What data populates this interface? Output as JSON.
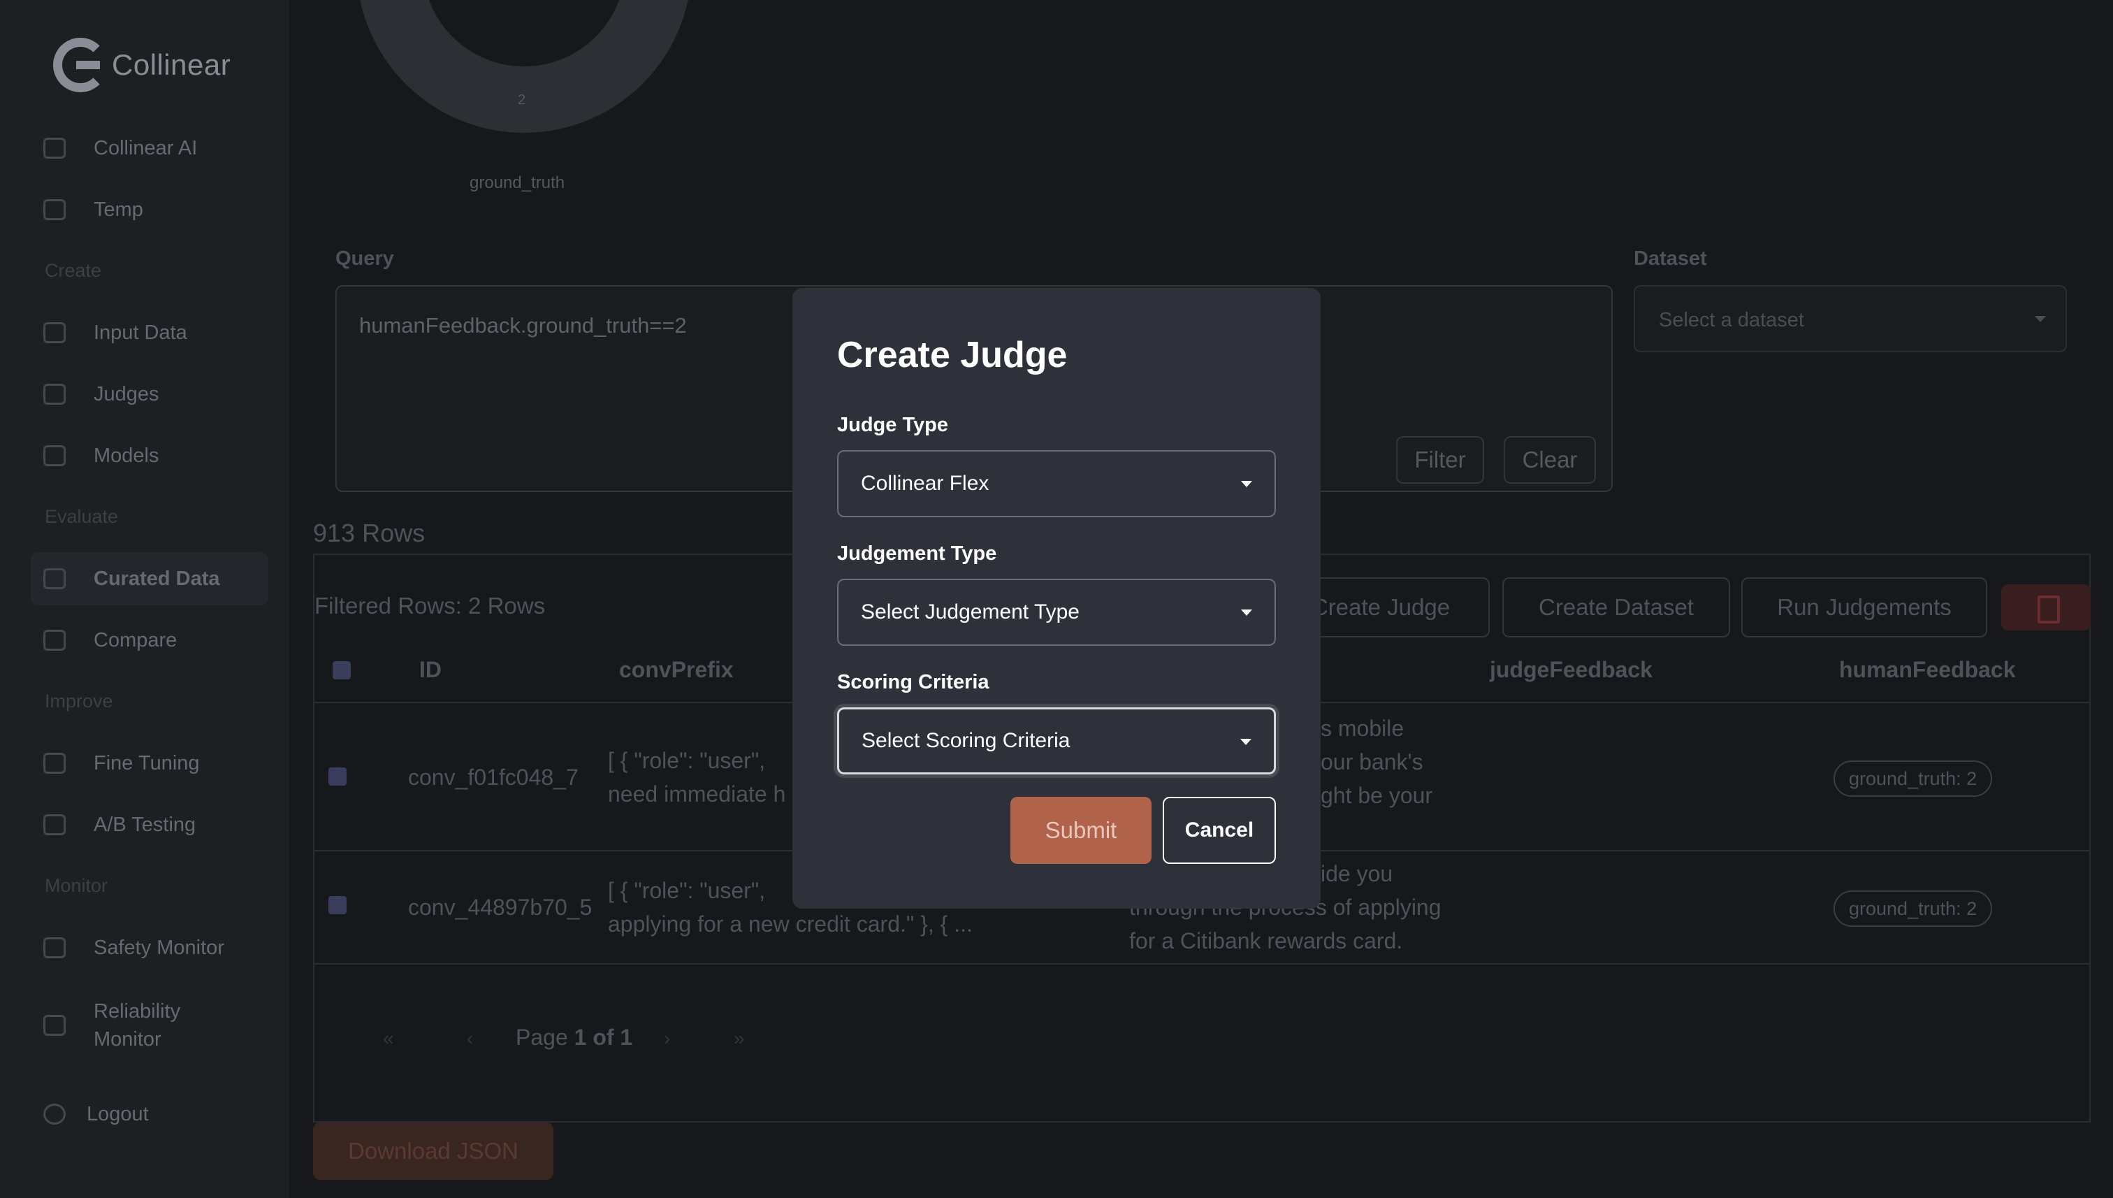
{
  "app": {
    "logo_text": "Collinear"
  },
  "sidebar": {
    "items": [
      {
        "label": "Collinear AI",
        "icon": "sparkle-icon"
      },
      {
        "label": "Temp",
        "icon": "grid-icon"
      },
      {
        "label": "Input Data",
        "icon": "table-icon"
      },
      {
        "label": "Judges",
        "icon": "scale-icon"
      },
      {
        "label": "Models",
        "icon": "model-icon"
      },
      {
        "label": "Curated Data",
        "icon": "list-icon",
        "active": true
      },
      {
        "label": "Compare",
        "icon": "compare-icon"
      },
      {
        "label": "Fine Tuning",
        "icon": "tune-icon"
      },
      {
        "label": "A/B Testing",
        "icon": "ab-icon"
      },
      {
        "label": "Safety Monitor",
        "icon": "monitor-icon"
      },
      {
        "label": "Reliability Monitor",
        "icon": "monitor-icon"
      }
    ],
    "sections": [
      "Create",
      "Evaluate",
      "Improve",
      "Monitor"
    ],
    "logout_label": "Logout"
  },
  "chart": {
    "center_value": "2",
    "label": "ground_truth"
  },
  "query": {
    "label": "Query",
    "value": "humanFeedback.ground_truth==2",
    "filter_label": "Filter",
    "clear_label": "Clear"
  },
  "dataset": {
    "label": "Dataset",
    "placeholder": "Select a dataset"
  },
  "table": {
    "rows_title": "913 Rows",
    "filtered_label": "Filtered Rows: 2 Rows",
    "buttons": {
      "create_judge": "Create Judge",
      "create_dataset": "Create Dataset",
      "run_judgements": "Run Judgements"
    },
    "columns": [
      "ID",
      "convPrefix",
      "judgeFeedback",
      "humanFeedback"
    ],
    "rows": [
      {
        "id": "conv_f01fc048_7",
        "prefix_line1": "[ { \"role\": \"user\",",
        "prefix_line2": "need immediate h",
        "resp_line1": "s mobile",
        "resp_line2": "our bank's",
        "resp_line3": "ght be your",
        "human": "ground_truth: 2"
      },
      {
        "id": "conv_44897b70_5",
        "prefix_line1": "[ { \"role\": \"user\",",
        "prefix_line2": "applying for a new credit card.\" }, { ...",
        "resp_line1": "ide you",
        "resp_line2": "through the process of applying",
        "resp_line3": "for a Citibank rewards card.",
        "human": "ground_truth: 2"
      }
    ],
    "pager": {
      "prefix": "Page",
      "current": "1",
      "of": "of",
      "total": "1"
    }
  },
  "download_label": "Download JSON",
  "modal": {
    "title": "Create Judge",
    "judge_type_label": "Judge Type",
    "judge_type_value": "Collinear Flex",
    "judgement_type_label": "Judgement Type",
    "judgement_type_value": "Select Judgement Type",
    "scoring_label": "Scoring Criteria",
    "scoring_value": "Select Scoring Criteria",
    "submit_label": "Submit",
    "cancel_label": "Cancel"
  }
}
